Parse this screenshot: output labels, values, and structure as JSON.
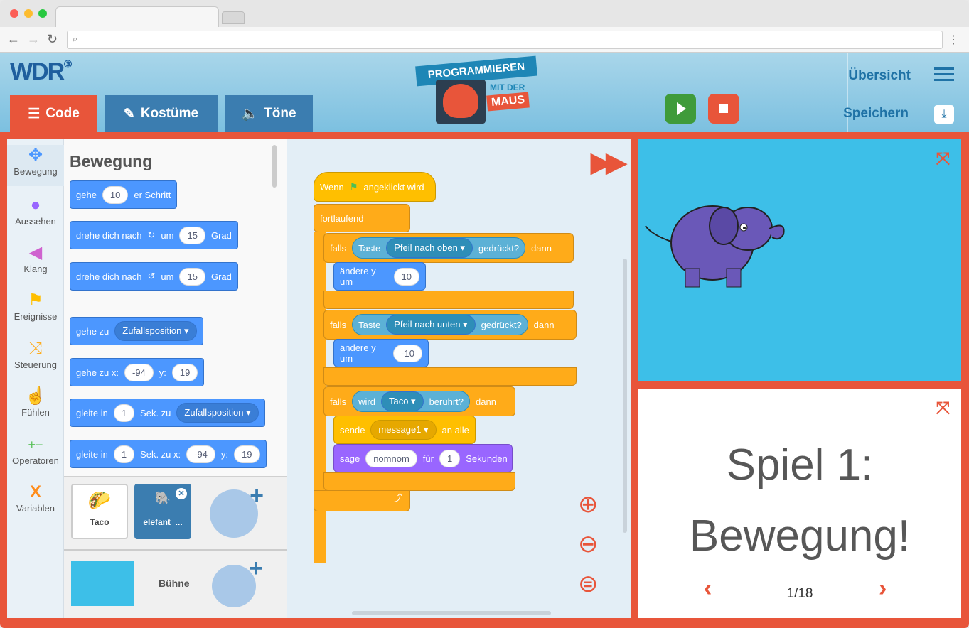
{
  "app": {
    "tabs": [
      {
        "label": "Code"
      },
      {
        "label": "Kostüme"
      },
      {
        "label": "Töne"
      }
    ],
    "logo": {
      "line1": "PROGRAMMIEREN",
      "line2": "MIT DER",
      "line3": "MAUS"
    },
    "links": {
      "overview": "Übersicht",
      "save": "Speichern"
    },
    "brand": "WDR"
  },
  "categories": [
    {
      "label": "Bewegung",
      "icon": "move-icon",
      "color": "#4c97ff"
    },
    {
      "label": "Aussehen",
      "icon": "person-icon",
      "color": "#9966ff"
    },
    {
      "label": "Klang",
      "icon": "speaker-icon",
      "color": "#cf63cf"
    },
    {
      "label": "Ereignisse",
      "icon": "flag-icon",
      "color": "#ffbf00"
    },
    {
      "label": "Steuerung",
      "icon": "shuffle-icon",
      "color": "#ffab19"
    },
    {
      "label": "Fühlen",
      "icon": "finger-icon",
      "color": "#5cb1d6"
    },
    {
      "label": "Operatoren",
      "icon": "plusminus-icon",
      "color": "#59c059"
    },
    {
      "label": "Variablen",
      "icon": "x-icon",
      "color": "#ff8c1a"
    }
  ],
  "palette": {
    "title": "Bewegung",
    "b1": {
      "a": "gehe",
      "v": "10",
      "b": "er Schritt"
    },
    "b2": {
      "a": "drehe dich nach",
      "m": "um",
      "v": "15",
      "b": "Grad"
    },
    "b3": {
      "a": "drehe dich nach",
      "m": "um",
      "v": "15",
      "b": "Grad"
    },
    "b4": {
      "a": "gehe zu",
      "dd": "Zufallsposition"
    },
    "b5": {
      "a": "gehe zu x:",
      "x": "-94",
      "y_label": "y:",
      "y": "19"
    },
    "b6": {
      "a": "gleite in",
      "v": "1",
      "m": "Sek. zu",
      "dd": "Zufallsposition"
    },
    "b7": {
      "a": "gleite in",
      "v": "1",
      "m": "Sek. zu x:",
      "x": "-94",
      "y_label": "y:",
      "y": "19"
    }
  },
  "sprites": [
    {
      "name": "Taco"
    },
    {
      "name": "elefant_..."
    }
  ],
  "stage_label": "Bühne",
  "script": {
    "hat": {
      "a": "Wenn",
      "b": "angeklickt wird"
    },
    "forever": "fortlaufend",
    "if1": {
      "falls": "falls",
      "key": "Taste",
      "dd": "Pfeil nach oben",
      "pressed": "gedrückt?",
      "then": "dann"
    },
    "set1": {
      "a": "ändere y um",
      "v": "10"
    },
    "if2": {
      "falls": "falls",
      "key": "Taste",
      "dd": "Pfeil nach unten",
      "pressed": "gedrückt?",
      "then": "dann"
    },
    "set2": {
      "a": "ändere y um",
      "v": "-10"
    },
    "if3": {
      "falls": "falls",
      "a": "wird",
      "dd": "Taco",
      "b": "berührt?",
      "then": "dann"
    },
    "send": {
      "a": "sende",
      "dd": "message1",
      "b": "an alle"
    },
    "say": {
      "a": "sage",
      "v": "nomnom",
      "m": "für",
      "n": "1",
      "b": "Sekunden"
    }
  },
  "lesson": {
    "line1": "Spiel 1:",
    "line2": "Bewegung!",
    "page": "1/18"
  }
}
